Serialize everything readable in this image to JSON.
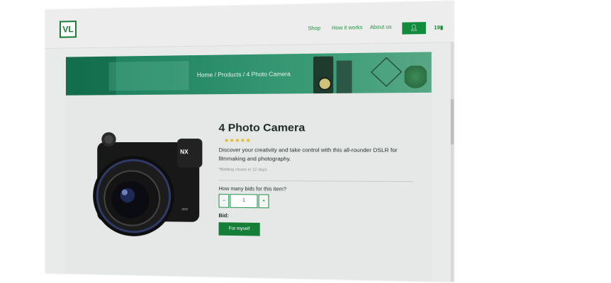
{
  "header": {
    "logo_text": "VL",
    "nav": {
      "shop": "Shop",
      "how_it_works": "How it works",
      "about_us": "About us"
    },
    "user_icon": "user-icon",
    "bids_count": "19"
  },
  "hero": {
    "breadcrumb": "Home / Products / 4 Photo Camera"
  },
  "product": {
    "title": "4 Photo Camera",
    "rating": 5,
    "stars": "★★★★★",
    "description": "Discover your creativity and take control with this all-rounder DSLR for filmmaking and photography.",
    "closing_note": "*Bidding closes in 12 days",
    "bid_question": "How many bids for this item?",
    "quantity": "1",
    "minus_label": "−",
    "plus_label": "+",
    "bid_label": "Bid:",
    "bid_button": "For myself"
  },
  "colors": {
    "accent_green": "#138b3d",
    "star_yellow": "#e3b51a"
  }
}
